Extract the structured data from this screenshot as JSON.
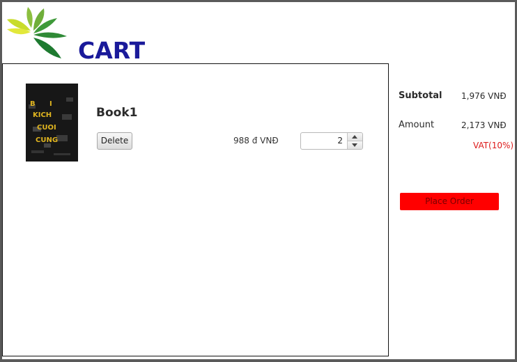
{
  "header": {
    "title": "CART",
    "logo_icon": "leaf-logo-icon"
  },
  "cart": {
    "items": [
      {
        "title": "Book1",
        "cover_text": "BI KICH CUOI CUNG",
        "price": "988 đ VNĐ",
        "quantity": "2",
        "delete_label": "Delete"
      }
    ]
  },
  "summary": {
    "subtotal_label": "Subtotal",
    "subtotal_value": "1,976 VNĐ",
    "amount_label": "Amount",
    "amount_value": "2,173 VNĐ",
    "vat_label": "VAT(10%)",
    "place_order_label": "Place Order"
  },
  "colors": {
    "title": "#1a1a9a",
    "place_order_bg": "#ff0000",
    "vat_text": "#dd1a1a",
    "frame": "#5a5a5a"
  }
}
